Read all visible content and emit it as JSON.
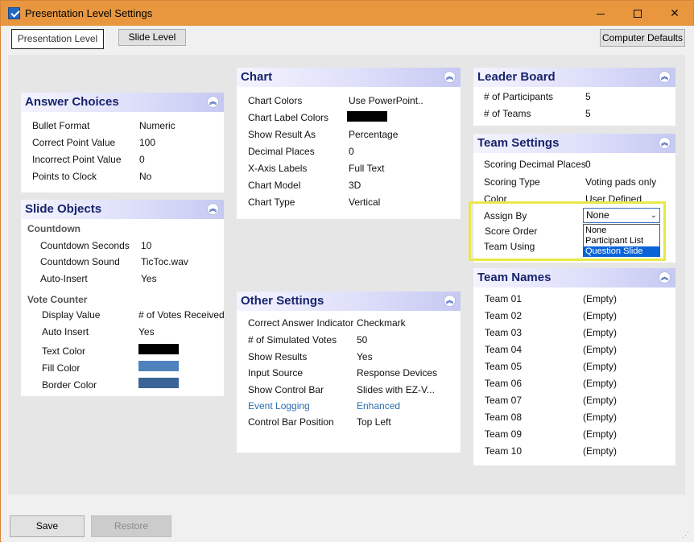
{
  "window": {
    "title": "Presentation Level Settings"
  },
  "tabs": {
    "presentation": "Presentation Level",
    "slide": "Slide Level"
  },
  "computer_defaults": "Computer Defaults",
  "answer_choices": {
    "title": "Answer Choices",
    "rows": [
      {
        "label": "Bullet Format",
        "value": "Numeric"
      },
      {
        "label": "Correct Point Value",
        "value": "100"
      },
      {
        "label": "Incorrect Point Value",
        "value": "0"
      },
      {
        "label": "Points to Clock",
        "value": "No"
      }
    ]
  },
  "slide_objects": {
    "title": "Slide Objects",
    "countdown": {
      "label": "Countdown",
      "rows": [
        {
          "label": "Countdown Seconds",
          "value": "10"
        },
        {
          "label": "Countdown Sound",
          "value": "TicToc.wav"
        },
        {
          "label": "Auto-Insert",
          "value": "Yes"
        }
      ]
    },
    "vote_counter": {
      "label": "Vote Counter",
      "rows": [
        {
          "label": "Display Value",
          "value": "# of Votes Received"
        },
        {
          "label": "Auto Insert",
          "value": "Yes"
        },
        {
          "label": "Text Color",
          "value": ""
        },
        {
          "label": "Fill Color",
          "value": ""
        },
        {
          "label": "Border Color",
          "value": ""
        }
      ]
    },
    "colors": {
      "text": "#000000",
      "fill": "#4f81bd",
      "border": "#3b6395"
    }
  },
  "chart": {
    "title": "Chart",
    "label_color": "#000000",
    "rows": [
      {
        "label": "Chart Colors",
        "value": "Use  PowerPoint.."
      },
      {
        "label": "Chart Label Colors",
        "value": ""
      },
      {
        "label": "Show Result As",
        "value": "Percentage"
      },
      {
        "label": "Decimal Places",
        "value": "0"
      },
      {
        "label": "X-Axis Labels",
        "value": "Full Text"
      },
      {
        "label": "Chart Model",
        "value": "3D"
      },
      {
        "label": "Chart Type",
        "value": "Vertical"
      }
    ]
  },
  "other_settings": {
    "title": "Other Settings",
    "rows": [
      {
        "label": "Correct Answer Indicator",
        "value": "Checkmark"
      },
      {
        "label": "# of Simulated Votes",
        "value": "50"
      },
      {
        "label": "Show Results",
        "value": "Yes"
      },
      {
        "label": "Input Source",
        "value": "Response Devices"
      },
      {
        "label": "Show Control Bar",
        "value": "Slides with EZ-V..."
      },
      {
        "label": "Event Logging",
        "value": "Enhanced"
      },
      {
        "label": "Control Bar Position",
        "value": "Top Left"
      }
    ]
  },
  "leader_board": {
    "title": "Leader Board",
    "rows": [
      {
        "label": "# of Participants",
        "value": "5"
      },
      {
        "label": "# of Teams",
        "value": "5"
      }
    ]
  },
  "team_settings": {
    "title": "Team Settings",
    "rows": [
      {
        "label": "Scoring Decimal Places",
        "value": "0"
      },
      {
        "label": "Scoring Type",
        "value": "Voting pads only"
      },
      {
        "label": "Color",
        "value": "User Defined"
      },
      {
        "label": "Assign By",
        "value": ""
      },
      {
        "label": "Score Order",
        "value": ""
      },
      {
        "label": "Team Using",
        "value": ""
      }
    ],
    "assign_by_selected": "None",
    "assign_by_options": [
      "None",
      "Participant List",
      "Question Slide"
    ]
  },
  "team_names": {
    "title": "Team Names",
    "rows": [
      {
        "label": "Team 01",
        "value": "(Empty)"
      },
      {
        "label": "Team 02",
        "value": "(Empty)"
      },
      {
        "label": "Team 03",
        "value": "(Empty)"
      },
      {
        "label": "Team 04",
        "value": "(Empty)"
      },
      {
        "label": "Team 05",
        "value": "(Empty)"
      },
      {
        "label": "Team 06",
        "value": "(Empty)"
      },
      {
        "label": "Team 07",
        "value": "(Empty)"
      },
      {
        "label": "Team 08",
        "value": "(Empty)"
      },
      {
        "label": "Team 09",
        "value": "(Empty)"
      },
      {
        "label": "Team 10",
        "value": "(Empty)"
      }
    ]
  },
  "footer": {
    "save": "Save",
    "restore": "Restore"
  },
  "icons": {
    "collapse": "double-chevron-up-icon",
    "app": "checkbox-app-icon"
  }
}
